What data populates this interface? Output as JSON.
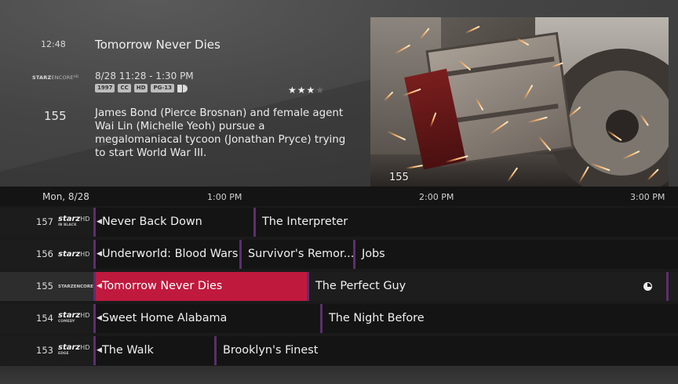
{
  "info": {
    "clock": "12:48",
    "network_logo_main": "STARZ",
    "network_logo_thin": "ENCORE",
    "network_logo_mark": "HD",
    "channel_number": "155",
    "title": "Tomorrow Never Dies",
    "airtime": "8/28  11:28 - 1:30 PM",
    "badges": [
      "1997",
      "CC",
      "HD",
      "PG-13"
    ],
    "rating_stars": 3,
    "rating_max": 4,
    "stars_filled": "★★★",
    "stars_empty": "★",
    "description": "James Bond (Pierce Brosnan) and female agent Wai Lin (Michelle Yeoh) pursue a megalomaniacal tycoon (Jonathan Pryce) trying to start World War III."
  },
  "video": {
    "channel_overlay": "155"
  },
  "guide": {
    "date": "Mon, 8/28",
    "times": [
      "1:00 PM",
      "2:00 PM",
      "3:00 PM"
    ],
    "rows": [
      {
        "channel": "157",
        "logo_main": "starz",
        "logo_hd": "HD",
        "logo_sub": "IN BLACK",
        "programs": [
          "Never Back Down",
          "The Interpreter"
        ]
      },
      {
        "channel": "156",
        "logo_main": "starz",
        "logo_hd": "HD",
        "logo_sub": "",
        "programs": [
          "Underworld: Blood Wars",
          "Survivor's Remor...",
          "Jobs"
        ]
      },
      {
        "channel": "155",
        "logo_main": "STARZENCORE",
        "logo_hd": "",
        "logo_sub": "",
        "programs": [
          "Tomorrow Never Dies",
          "The Perfect Guy"
        ]
      },
      {
        "channel": "154",
        "logo_main": "starz",
        "logo_hd": "HD",
        "logo_sub": "COMEDY",
        "programs": [
          "Sweet Home Alabama",
          "The Night Before"
        ]
      },
      {
        "channel": "153",
        "logo_main": "starz",
        "logo_hd": "HD",
        "logo_sub": "EDGE",
        "programs": [
          "The Walk",
          "Brooklyn's Finest"
        ]
      }
    ]
  },
  "colors": {
    "selected": "#c0193e",
    "separator": "#5c2f6c"
  }
}
